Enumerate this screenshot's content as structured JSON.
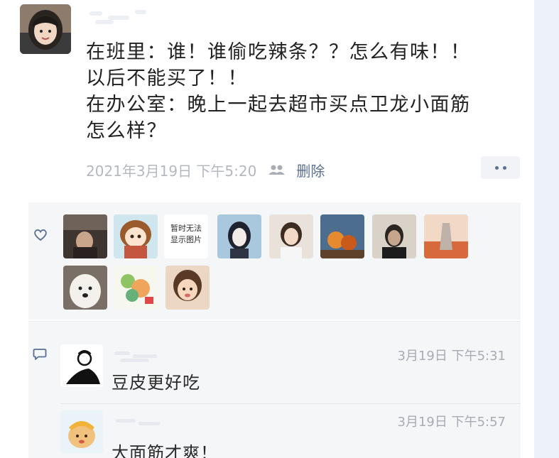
{
  "post": {
    "lines": [
      "在班里：谁！谁偷吃辣条？？怎么有味！！",
      "以后不能买了！！",
      "在办公室：晚上一起去超市买点卫龙小面筋",
      "怎么样？"
    ],
    "timestamp": "2021年3月19日 下午5:20",
    "delete_label": "删除"
  },
  "likes": {
    "avatars": [
      {
        "name": "like-avatar-1"
      },
      {
        "name": "like-avatar-2"
      },
      {
        "name": "like-avatar-3",
        "text_lines": [
          "暂时无法",
          "显示图片"
        ]
      },
      {
        "name": "like-avatar-4"
      },
      {
        "name": "like-avatar-5"
      },
      {
        "name": "like-avatar-6"
      },
      {
        "name": "like-avatar-7"
      },
      {
        "name": "like-avatar-8"
      },
      {
        "name": "like-avatar-9"
      },
      {
        "name": "like-avatar-10"
      },
      {
        "name": "like-avatar-11"
      }
    ]
  },
  "comments": [
    {
      "time": "3月19日 下午5:31",
      "text": "豆皮更好吃"
    },
    {
      "time": "3月19日 下午5:57",
      "text": "大面筋才爽！"
    }
  ],
  "icons": {
    "like": "heart-icon",
    "comment": "comment-icon",
    "visibility": "group-icon",
    "more": "more-dots-icon"
  },
  "colors": {
    "link": "#5a6f93",
    "meta_text": "#b4b8bf",
    "panel_bg": "#f5f6f8",
    "side_strip": "#edf2f9"
  }
}
